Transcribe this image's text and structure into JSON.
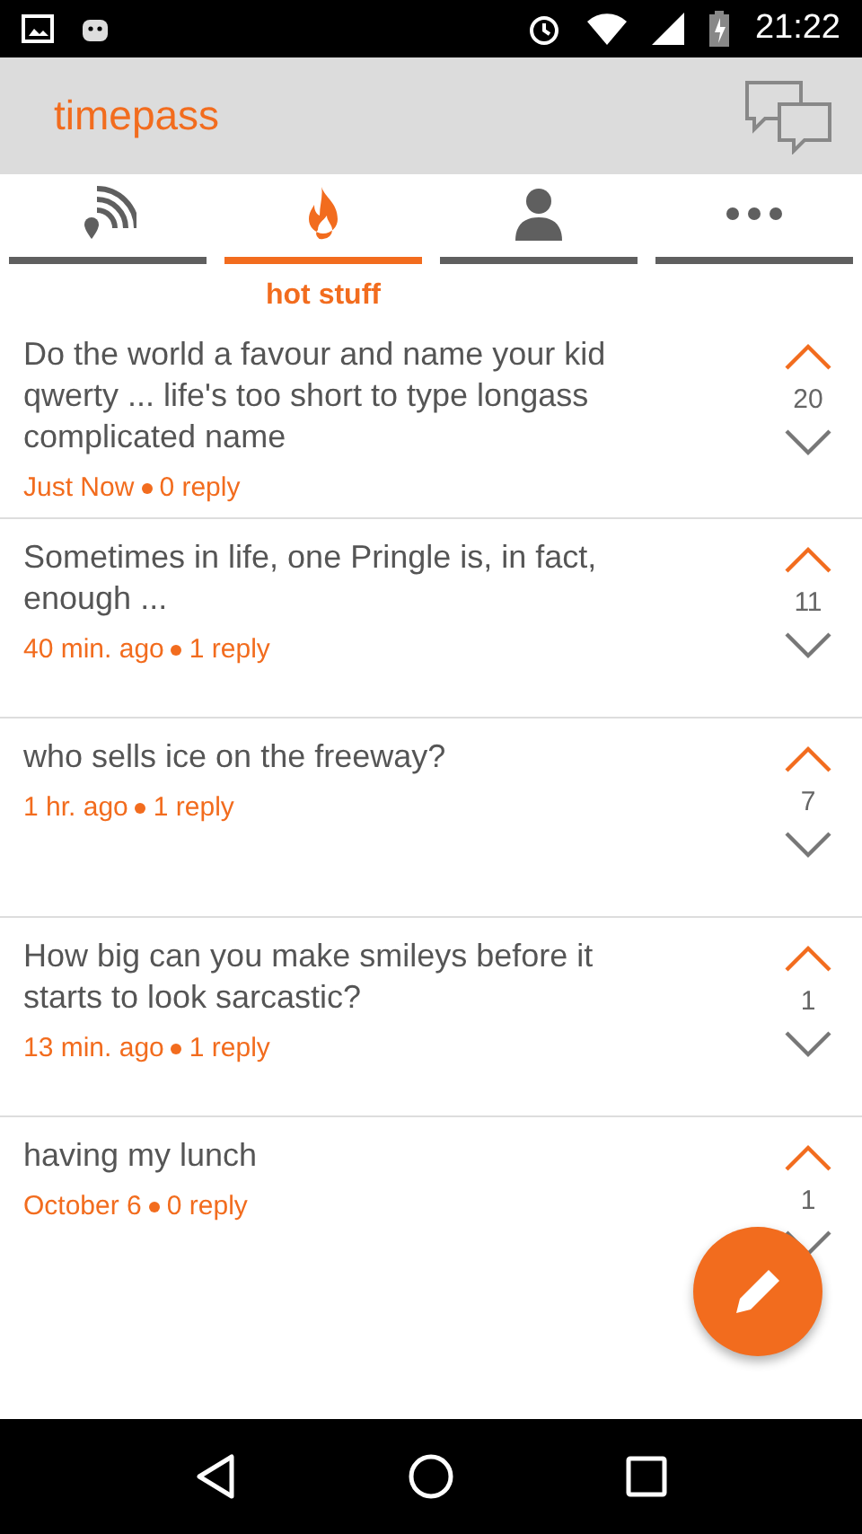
{
  "status_bar": {
    "time": "21:22"
  },
  "app_bar": {
    "title": "timepass"
  },
  "tabs": [
    {
      "kind": "feed",
      "selected": false
    },
    {
      "kind": "fire",
      "selected": true,
      "label": "hot stuff"
    },
    {
      "kind": "person",
      "selected": false
    },
    {
      "kind": "more",
      "selected": false
    }
  ],
  "posts": [
    {
      "text": "Do the world a favour and name your kid qwerty ... life's too short to type longass complicated name",
      "time": "Just Now",
      "replies": "0 reply",
      "votes": "20"
    },
    {
      "text": "Sometimes in life, one Pringle is, in fact, enough ...",
      "time": "40 min. ago",
      "replies": "1 reply",
      "votes": "11"
    },
    {
      "text": "who sells ice on the freeway?",
      "time": "1 hr. ago",
      "replies": "1 reply",
      "votes": "7"
    },
    {
      "text": "How big can you make smileys before it starts to look sarcastic?",
      "time": "13 min. ago",
      "replies": "1 reply",
      "votes": "1"
    },
    {
      "text": "having my lunch",
      "time": "October 6",
      "replies": "0 reply",
      "votes": "1"
    }
  ]
}
